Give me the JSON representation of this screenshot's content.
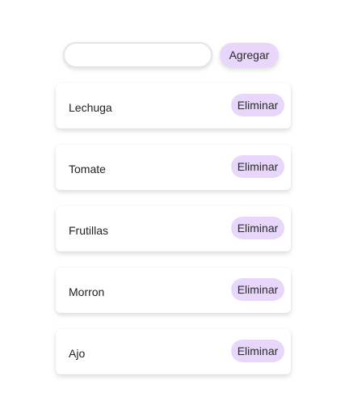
{
  "form": {
    "input_value": "",
    "input_placeholder": "",
    "add_label": "Agregar"
  },
  "items": [
    {
      "label": "Lechuga",
      "delete_label": "Eliminar"
    },
    {
      "label": "Tomate",
      "delete_label": "Eliminar"
    },
    {
      "label": "Frutillas",
      "delete_label": "Eliminar"
    },
    {
      "label": "Morron",
      "delete_label": "Eliminar"
    },
    {
      "label": "Ajo",
      "delete_label": "Eliminar"
    }
  ],
  "colors": {
    "button_bg": "#e8d6fb",
    "input_border": "#e4e4e4"
  }
}
